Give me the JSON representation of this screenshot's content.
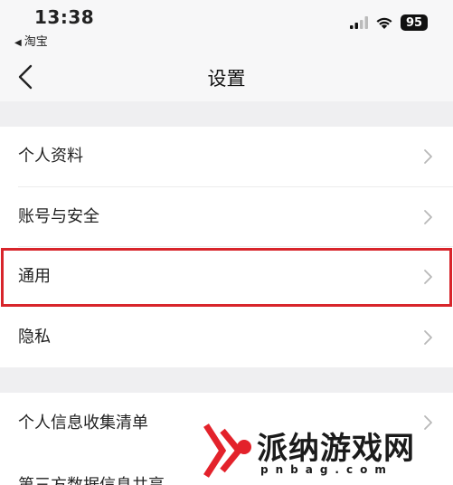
{
  "status_bar": {
    "time": "13:38",
    "back_app": "淘宝",
    "battery": "95"
  },
  "nav": {
    "title": "设置",
    "back_icon": "chevron-left-icon"
  },
  "settings_group_1": [
    {
      "label": "个人资料",
      "icon": "chevron-right-icon"
    },
    {
      "label": "账号与安全",
      "icon": "chevron-right-icon"
    },
    {
      "label": "通用",
      "icon": "chevron-right-icon",
      "highlighted": true
    },
    {
      "label": "隐私",
      "icon": "chevron-right-icon"
    }
  ],
  "settings_group_2": [
    {
      "label": "个人信息收集清单",
      "icon": "chevron-right-icon"
    },
    {
      "label": "第三方数据信息共享"
    }
  ],
  "watermark": {
    "text": "派纳游戏网",
    "url": "pnbag.com"
  },
  "colors": {
    "highlight": "#d8252b",
    "watermark_red": "#e3222b",
    "background": "#efeff1"
  }
}
